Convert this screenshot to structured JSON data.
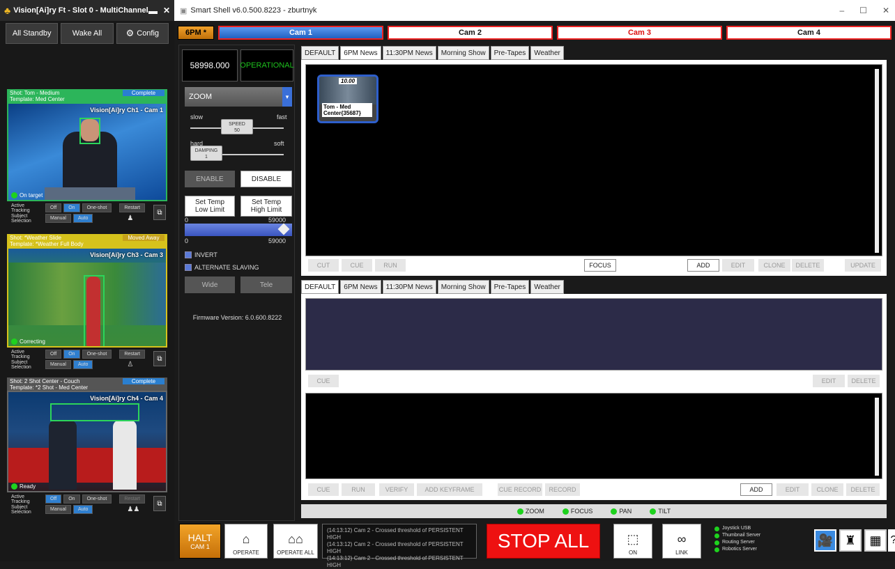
{
  "left_window": {
    "title": "Vision[Ai]ry Ft - Slot 0 - MultiChannel",
    "buttons": {
      "all_standby": "All Standby",
      "wake_all": "Wake All",
      "config": "Config"
    },
    "slots": [
      {
        "shot": "Shot: Tom - Medium",
        "template": "Template: Med Center",
        "status": "Complete",
        "status_color": "#2a7fd0",
        "color": "#2cb55a",
        "channel": "Vision[Ai]ry Ch1 - Cam 1",
        "video_status": "On target",
        "tracking": "Active Tracking",
        "tracking_opts": [
          "Off",
          "On",
          "One-shot",
          "Restart"
        ],
        "subject": "Subject Selection",
        "subject_opts": [
          "Manual",
          "Auto"
        ]
      },
      {
        "shot": "Shot: *Weather Slide",
        "template": "Template: *Weather Full Body",
        "status": "Moved Away",
        "status_color": "#c7a21a",
        "color": "#d6c21c",
        "channel": "Vision[Ai]ry Ch3 - Cam 3",
        "video_status": "Correcting",
        "tracking": "Active Tracking",
        "tracking_opts": [
          "Off",
          "On",
          "One-shot",
          "Restart"
        ],
        "subject": "Subject Selection",
        "subject_opts": [
          "Manual",
          "Auto"
        ]
      },
      {
        "shot": "Shot: 2 Shot Center - Couch",
        "template": "Template: *2 Shot - Med Center",
        "status": "Complete",
        "status_color": "#2a7fd0",
        "color": "#888888",
        "channel": "Vision[Ai]ry Ch4 - Cam 4",
        "video_status": "Ready",
        "tracking": "Active Tracking",
        "tracking_opts": [
          "Off",
          "On",
          "One-shot",
          "Restart"
        ],
        "subject": "Subject Selection",
        "subject_opts": [
          "Manual",
          "Auto"
        ]
      }
    ]
  },
  "main_window": {
    "title": "Smart Shell v6.0.500.8223 - zburtnyk",
    "show_button": "6PM *",
    "cams": [
      "Cam 1",
      "Cam 2",
      "Cam 3",
      "Cam 4"
    ],
    "value_display": "58998.000",
    "operational": "OPERATIONAL",
    "mode_select": "ZOOM",
    "speed": {
      "slow": "slow",
      "fast": "fast",
      "label": "SPEED",
      "value": "50"
    },
    "damping": {
      "hard": "hard",
      "soft": "soft",
      "label": "DAMPING",
      "value": "1"
    },
    "enable": "ENABLE",
    "disable": "DISABLE",
    "set_low": "Set Temp\nLow Limit",
    "set_high": "Set Temp\nHigh Limit",
    "range1": {
      "min": "0",
      "max": "59000"
    },
    "range2": {
      "min": "0",
      "max": "59000"
    },
    "invert": "INVERT",
    "alt_slaving": "ALTERNATE SLAVING",
    "wide": "Wide",
    "tele": "Tele",
    "firmware": "Firmware Version: 6.0.600.8222",
    "tabs": [
      "DEFAULT",
      "6PM News",
      "11:30PM News",
      "Morning Show",
      "Pre-Tapes",
      "Weather"
    ],
    "shot_card": {
      "time": "10.00",
      "label": "Tom - Med Center{35687}"
    },
    "bar1": [
      "CUT",
      "CUE",
      "RUN",
      "FOCUS",
      "ADD",
      "EDIT",
      "CLONE",
      "DELETE",
      "UPDATE"
    ],
    "bar2": [
      "CUE",
      "EDIT",
      "DELETE"
    ],
    "bar3": [
      "CUE",
      "RUN",
      "VERIFY",
      "ADD KEYFRAME",
      "CUE RECORD",
      "RECORD",
      "ADD",
      "EDIT",
      "CLONE",
      "DELETE"
    ],
    "status": [
      "ZOOM",
      "FOCUS",
      "PAN",
      "TILT"
    ],
    "halt": "HALT",
    "halt_sub": "CAM 1",
    "operate": "OPERATE",
    "operate_all": "OPERATE ALL",
    "logs": [
      "(14:13:12) Cam 2 - Crossed threshold of  PERSISTENT HIGH",
      "(14:13:12) Cam 2 - Crossed threshold of  PERSISTENT HIGH",
      "(14:13:12) Cam 2 - Crossed threshold of  PERSISTENT HIGH"
    ],
    "stop_all": "STOP ALL",
    "ai_on": "ON",
    "link": "LINK",
    "servers": [
      "Joystick USB",
      "Thumbnail Server",
      "Routing Server",
      "Robotics Server"
    ],
    "help": "?"
  }
}
